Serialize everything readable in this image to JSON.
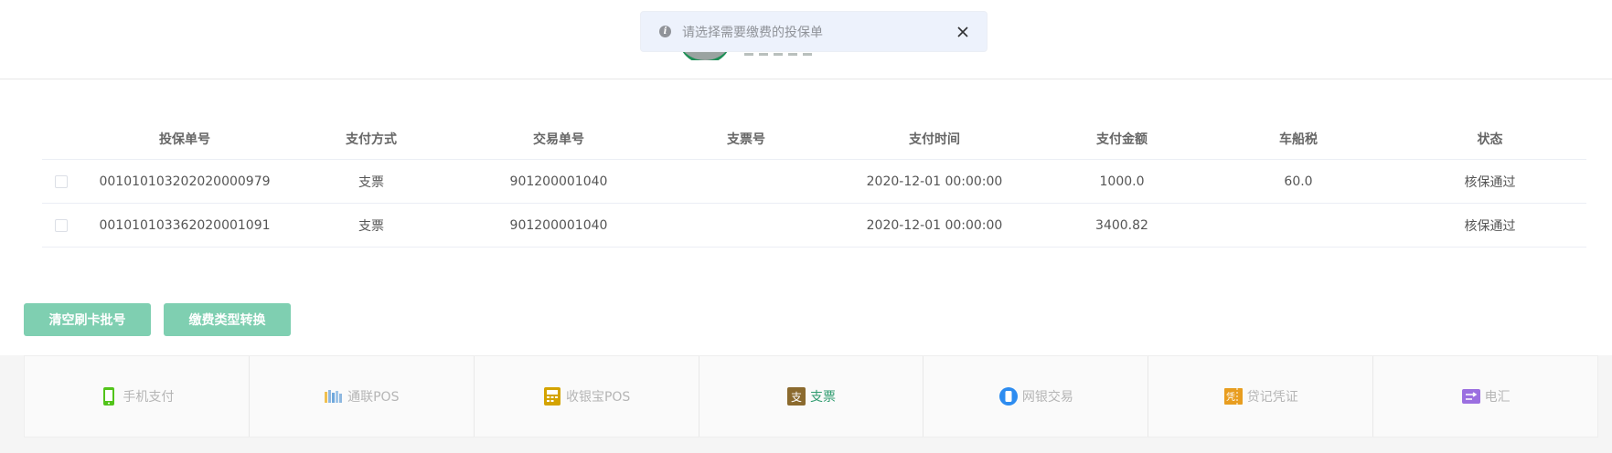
{
  "toast": {
    "message": "请选择需要缴费的投保单"
  },
  "table": {
    "headers": [
      "投保单号",
      "支付方式",
      "交易单号",
      "支票号",
      "支付时间",
      "支付金额",
      "车船税",
      "状态"
    ],
    "rows": [
      {
        "policy_no": "001010103202020000979",
        "pay_method": "支票",
        "trade_no": "901200001040",
        "cheque_no": "",
        "pay_time": "2020-12-01 00:00:00",
        "amount": "1000.0",
        "vessel_tax": "60.0",
        "status": "核保通过"
      },
      {
        "policy_no": "001010103362020001091",
        "pay_method": "支票",
        "trade_no": "901200001040",
        "cheque_no": "",
        "pay_time": "2020-12-01 00:00:00",
        "amount": "3400.82",
        "vessel_tax": "",
        "status": "核保通过"
      }
    ]
  },
  "buttons": {
    "clear_batch": "清空刷卡批号",
    "convert_type": "缴费类型转换"
  },
  "pay_tabs": [
    {
      "label": "手机支付",
      "icon": "mobile-phone-icon",
      "color": "#52c41a"
    },
    {
      "label": "通联POS",
      "icon": "allinpay-pos-icon",
      "color": "#8fb8e0"
    },
    {
      "label": "收银宝POS",
      "icon": "pos-terminal-icon",
      "color": "#d4a300"
    },
    {
      "label": "支票",
      "icon": "cheque-icon",
      "color": "#8b6a2e",
      "active": true
    },
    {
      "label": "网银交易",
      "icon": "online-bank-icon",
      "color": "#2d8cf0"
    },
    {
      "label": "贷记凭证",
      "icon": "credit-voucher-icon",
      "color": "#e89d1f"
    },
    {
      "label": "电汇",
      "icon": "wire-transfer-icon",
      "color": "#9b6fe0"
    }
  ],
  "colors": {
    "accent": "#7fcfb1",
    "active_tab": "#2f9b6f"
  }
}
